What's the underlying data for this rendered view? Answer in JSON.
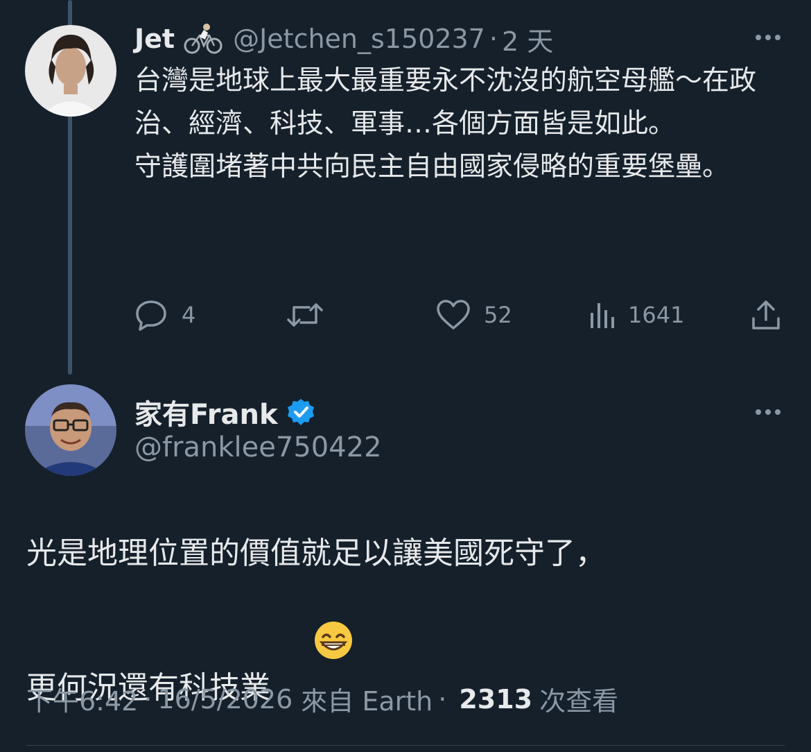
{
  "reply": {
    "name": "Jet",
    "handle": "@Jetchen_s150237",
    "time": "2 天",
    "text": "台灣是地球上最大最重要永不沈沒的航空母艦～在政治、經濟、科技、軍事…各個方面皆是如此。\n守護圍堵著中共向民主自由國家侵略的重要堡壘。",
    "replies": "4",
    "retweets": "",
    "likes": "52",
    "views": "1641"
  },
  "main": {
    "name": "家有Frank",
    "handle": "@franklee750422",
    "verified": true,
    "text": "光是地理位置的價值就足以讓美國死守了，\n更何況還有科技業",
    "emoji": "grinning-face",
    "time": "下午6:42",
    "date": "16/5/2026",
    "source": "來自 Earth",
    "views_count": "2313",
    "views_label": "次查看"
  },
  "colors": {
    "background": "#15202b",
    "text": "#e7e9ea",
    "secondary": "#8b98a5",
    "verified": "#1d9bf0"
  }
}
